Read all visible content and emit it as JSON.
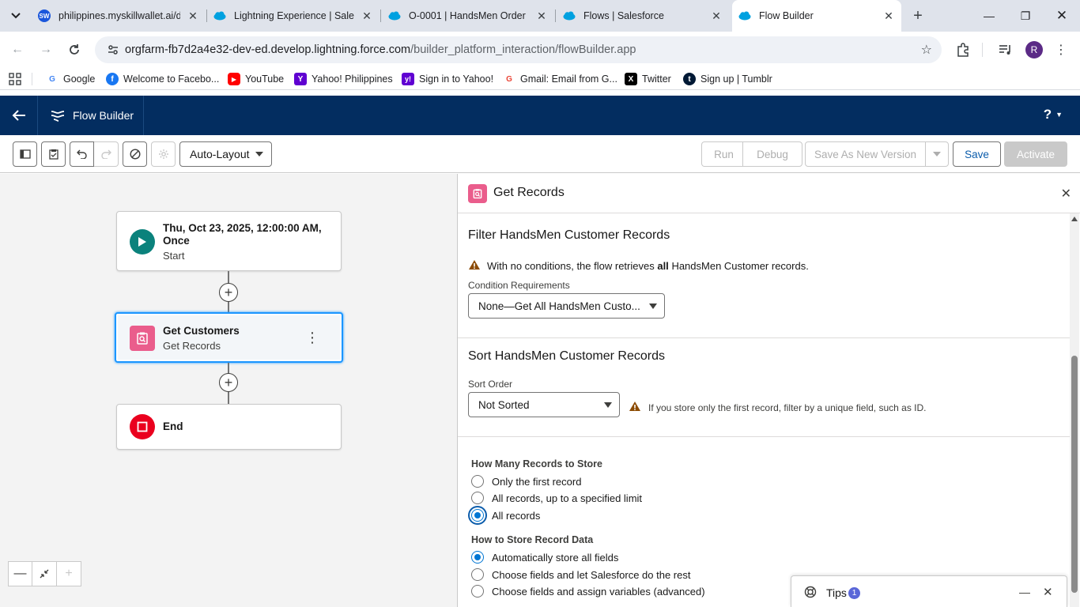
{
  "browser": {
    "tabs": [
      {
        "title": "philippines.myskillwallet.ai/d",
        "favicon": "sw-icon",
        "favicon_text": "SW",
        "color": "#1a56db"
      },
      {
        "title": "Lightning Experience | Salesf",
        "favicon": "salesforce-cloud-icon",
        "color": "#00a1e0"
      },
      {
        "title": "O-0001 | HandsMen Order |",
        "favicon": "salesforce-cloud-icon",
        "color": "#00a1e0"
      },
      {
        "title": "Flows | Salesforce",
        "favicon": "salesforce-cloud-icon",
        "color": "#00a1e0"
      },
      {
        "title": "Flow Builder",
        "favicon": "salesforce-cloud-icon",
        "color": "#00a1e0",
        "active": true
      }
    ],
    "url_host": "orgfarm-fb7d2a4e32-dev-ed.develop.lightning.force.com",
    "url_path": "/builder_platform_interaction/flowBuilder.app",
    "profile_initial": "R",
    "bookmarks": [
      {
        "label": "Google",
        "icon": "google-icon"
      },
      {
        "label": "Welcome to Facebo...",
        "icon": "facebook-icon"
      },
      {
        "label": "YouTube",
        "icon": "youtube-icon"
      },
      {
        "label": "Yahoo! Philippines",
        "icon": "yahoo-icon"
      },
      {
        "label": "Sign in to Yahoo!",
        "icon": "yahoo-mail-icon"
      },
      {
        "label": "Gmail: Email from G...",
        "icon": "google-icon"
      },
      {
        "label": "Twitter",
        "icon": "x-icon"
      },
      {
        "label": "Sign up | Tumblr",
        "icon": "tumblr-icon"
      }
    ]
  },
  "sf_header": {
    "app_name": "Flow Builder",
    "help": "?"
  },
  "toolbar": {
    "layout_select": "Auto-Layout",
    "run": "Run",
    "debug": "Debug",
    "save_as_new": "Save As New Version",
    "save": "Save",
    "activate": "Activate"
  },
  "canvas": {
    "start": {
      "title_line1": "Thu, Oct 23, 2025, 12:00:00 AM,",
      "title_line2": "Once",
      "subtitle": "Start"
    },
    "get_records": {
      "title": "Get Customers",
      "subtitle": "Get Records"
    },
    "end": {
      "title": "End"
    }
  },
  "panel": {
    "title": "Get Records",
    "filter": {
      "title": "Filter HandsMen Customer Records",
      "warning_prefix": "With no conditions, the flow retrieves",
      "warning_bold": "all",
      "warning_suffix": "HandsMen Customer records.",
      "cond_label": "Condition Requirements",
      "cond_value": "None—Get All HandsMen Custo..."
    },
    "sort": {
      "title": "Sort HandsMen Customer Records",
      "order_label": "Sort Order",
      "order_value": "Not Sorted",
      "hint": "If you store only the first record, filter by a unique field, such as ID."
    },
    "how_many": {
      "title": "How Many Records to Store",
      "options": [
        "Only the first record",
        "All records, up to a specified limit",
        "All records"
      ],
      "selected": "All records"
    },
    "how_store": {
      "title": "How to Store Record Data",
      "options": [
        "Automatically store all fields",
        "Choose fields and let Salesforce do the rest",
        "Choose fields and assign variables (advanced)"
      ],
      "selected": "Automatically store all fields"
    }
  },
  "tips": {
    "label": "Tips",
    "count": "1"
  }
}
